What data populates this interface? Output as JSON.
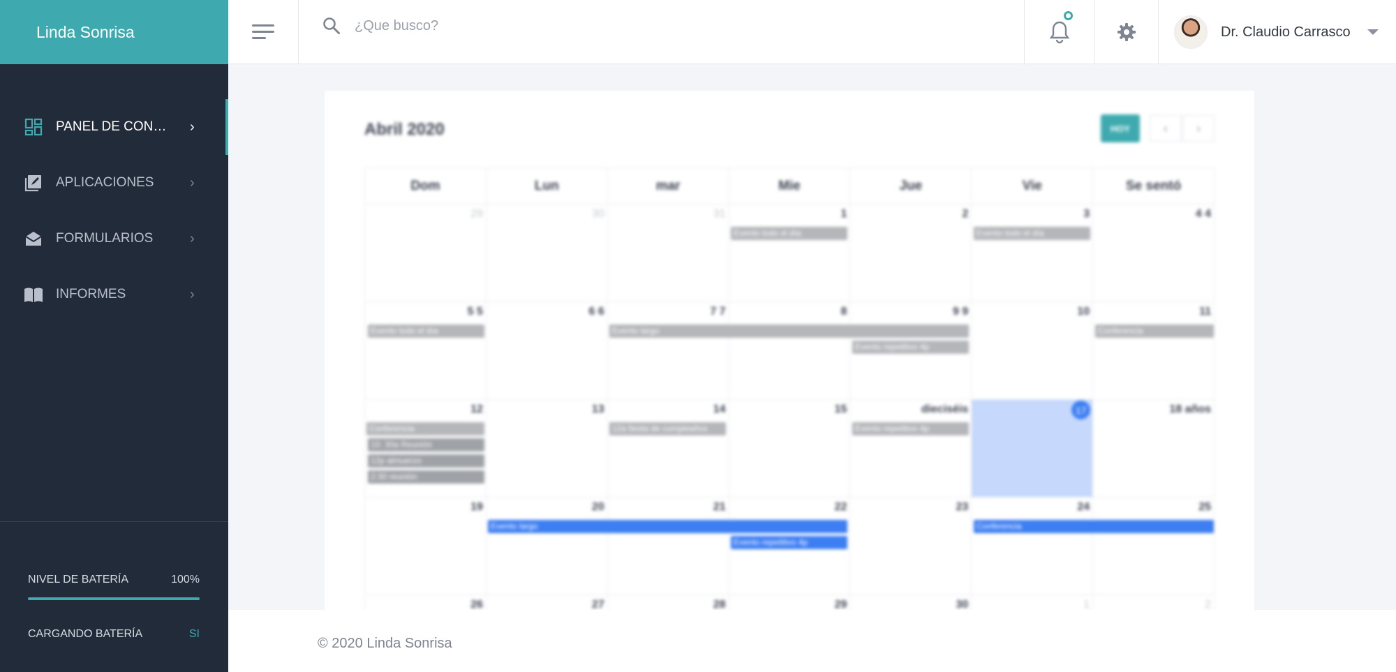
{
  "brand": "Linda Sonrisa",
  "sidebar": {
    "items": [
      {
        "label": "PANEL DE CONTROL",
        "icon": "dashboard-icon"
      },
      {
        "label": "APLICACIONES",
        "icon": "edit-note-icon"
      },
      {
        "label": "FORMULARIOS",
        "icon": "mail-open-icon"
      },
      {
        "label": "INFORMES",
        "icon": "book-icon"
      }
    ],
    "battery_label": "NIVEL DE BATERÍA",
    "battery_value": "100%",
    "battery_level": 1.0,
    "charging_label": "CARGANDO BATERÍA",
    "charging_value": "SI"
  },
  "topbar": {
    "search_placeholder": "¿Que busco?",
    "user_name": "Dr. Claudio Carrasco"
  },
  "calendar": {
    "title": "Abril 2020",
    "today_label": "HOY",
    "prev": "‹",
    "next": "›",
    "weekdays": [
      "Dom",
      "Lun",
      "mar",
      "Mie",
      "Jue",
      "Vie",
      "Se sentó"
    ],
    "weeks": [
      [
        "29",
        "30",
        "31",
        "1",
        "2",
        "3",
        "4 4"
      ],
      [
        "5 5",
        "6 6",
        "7 7",
        "8",
        "9 9",
        "10",
        "11"
      ],
      [
        "12",
        "13",
        "14",
        "15",
        "dieciséis",
        "17",
        "18 años"
      ],
      [
        "19",
        "20",
        "21",
        "22",
        "23",
        "24",
        "25"
      ],
      [
        "26",
        "27",
        "28",
        "29",
        "30",
        "1",
        "2"
      ]
    ],
    "events": {
      "all_day": "Evento todo el día",
      "long": "Evento largo",
      "repeating": "Evento repetitivo 4p",
      "conference": "Conferencia",
      "meeting": "10: 30a Reunión",
      "lunch": "12p almuerzo",
      "meeting2": "2:30 reunión",
      "birthday": "12a fiesta de cumpleaños"
    }
  },
  "footer": "© 2020 Linda Sonrisa",
  "colors": {
    "accent": "#3eaaaf",
    "sidebar": "#222b3a",
    "event_blue": "#3d7ef3",
    "today_bg": "#c6d8fb"
  }
}
